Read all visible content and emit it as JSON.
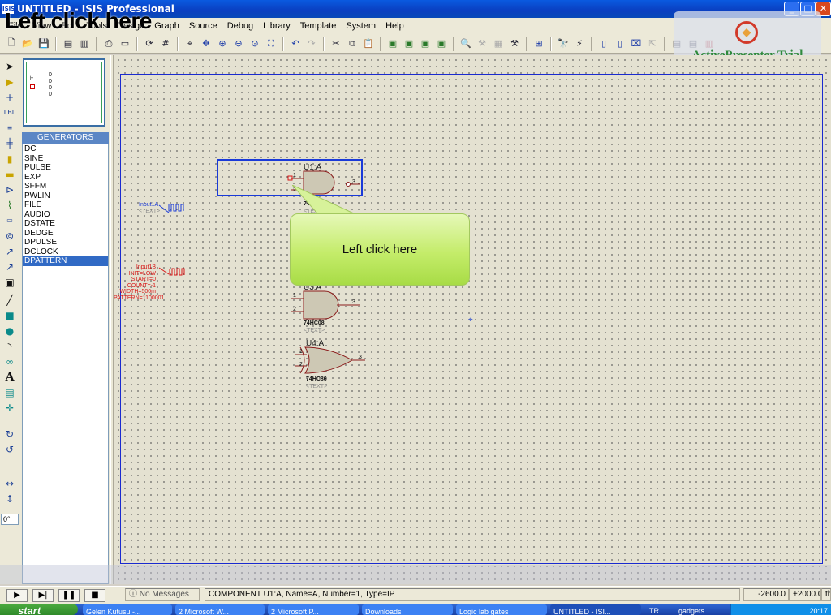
{
  "window": {
    "icon_text": "ISIS",
    "title": "UNTITLED - ISIS Professional",
    "min_glyph": "_",
    "max_glyph": "□",
    "close_glyph": "✕"
  },
  "overlay_caption": "Left click here",
  "menu": [
    "File",
    "View",
    "Edit",
    "Tools",
    "Design",
    "Graph",
    "Source",
    "Debug",
    "Library",
    "Template",
    "System",
    "Help"
  ],
  "watermark": {
    "text": "ActivePresenter Trial"
  },
  "panel": {
    "list_header": "GENERATORS",
    "items": [
      "DC",
      "SINE",
      "PULSE",
      "EXP",
      "SFFM",
      "PWLIN",
      "FILE",
      "AUDIO",
      "DSTATE",
      "DEDGE",
      "DPULSE",
      "DCLOCK",
      "DPATTERN"
    ],
    "selected": "DPATTERN",
    "angle_value": "0°"
  },
  "schematic": {
    "u1": {
      "ref": "U1:A",
      "part": "74HC00",
      "tmpl": "<TEXT>",
      "pins": [
        "1",
        "2",
        "3"
      ]
    },
    "u3": {
      "ref": "U3:A",
      "part": "74HC08",
      "tmpl": "<TEXT>",
      "pins": [
        "1",
        "2",
        "3"
      ]
    },
    "u4": {
      "ref": "U4:A",
      "part": "74HC86",
      "tmpl": "<TEXT>",
      "pins": [
        "1",
        "2",
        "3"
      ]
    },
    "gen1": {
      "name": "Input1A",
      "tmpl": "<TEXT>"
    },
    "gen2": {
      "lines": [
        "Input1B",
        "INIT=LOW",
        "START=0",
        "COUNT=-1",
        "WIDTH=500m",
        "PATTERN=1100001"
      ]
    }
  },
  "callout_text": "Left click here",
  "status": {
    "messages": "No Messages",
    "component": "COMPONENT U1:A, Name=A, Number=1, Type=IP",
    "coord_x": "-2600.0",
    "coord_y": "+2000.0",
    "units": "th"
  },
  "taskbar": {
    "start": "start",
    "tasks": [
      "Gelen Kutusu -...",
      "2 Microsoft W...",
      "2 Microsoft P...",
      "Downloads",
      "Logic lab gates",
      "UNTITLED - ISI..."
    ],
    "lang": "TR",
    "extra": "gadgets",
    "clock": "20:17"
  }
}
